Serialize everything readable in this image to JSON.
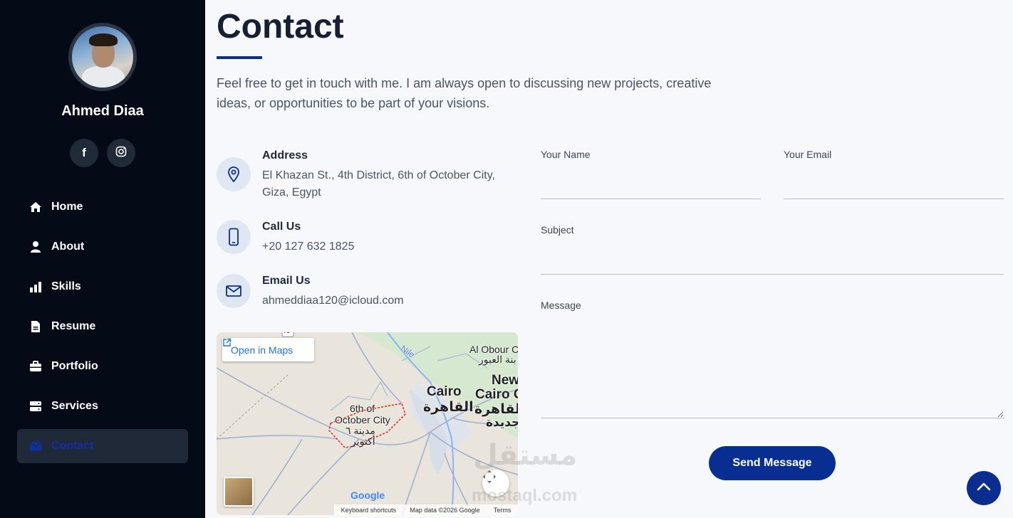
{
  "sidebar": {
    "profile_name": "Ahmed Diaa",
    "social": [
      {
        "icon": "facebook-icon",
        "glyph": "f"
      },
      {
        "icon": "instagram-icon"
      }
    ],
    "nav": [
      {
        "label": "Home",
        "icon": "home-icon"
      },
      {
        "label": "About",
        "icon": "user-icon"
      },
      {
        "label": "Skills",
        "icon": "bar-chart-icon"
      },
      {
        "label": "Resume",
        "icon": "document-icon"
      },
      {
        "label": "Portfolio",
        "icon": "briefcase-icon"
      },
      {
        "label": "Services",
        "icon": "server-icon"
      },
      {
        "label": "Contact",
        "icon": "envelope-icon",
        "active": true
      }
    ]
  },
  "main": {
    "title": "Contact",
    "intro": "Feel free to get in touch with me. I am always open to discussing new projects, creative ideas, or opportunities to be part of your visions.",
    "info": [
      {
        "label": "Address",
        "text": "El Khazan St., 4th District, 6th of October City, Giza, Egypt",
        "icon": "map-pin-icon"
      },
      {
        "label": "Call Us",
        "text": "+20 127 632 1825",
        "icon": "phone-icon"
      },
      {
        "label": "Email Us",
        "text": "ahmeddiaa120@icloud.com",
        "icon": "mail-icon"
      }
    ],
    "map": {
      "open_label": "Open in Maps",
      "labels": {
        "cairo": "Cairo",
        "cairo_ar": "القاهرة",
        "new_cairo": "New",
        "new_cairo2": "Cairo C",
        "new_cairo_ar": "القاهرة",
        "new_cairo_ar2": "جديدة",
        "obour": "Al Obour C",
        "obour_ar": "بنة العبور",
        "october1": "6th of",
        "october2": "October City",
        "october_ar1": "مدينة ٦",
        "october_ar2": "أكتوبر",
        "nile": "Nile",
        "road": "75"
      },
      "google": "Google",
      "footer": [
        "Keyboard shortcuts",
        "Map data ©2026 Google",
        "Terms"
      ]
    },
    "form": {
      "name_label": "Your Name",
      "email_label": "Your Email",
      "subject_label": "Subject",
      "message_label": "Message",
      "name_value": "",
      "email_value": "",
      "subject_value": "",
      "message_value": "",
      "send_label": "Send Message"
    },
    "watermark": "مستقل",
    "watermark_sub": "mostaql.com"
  }
}
